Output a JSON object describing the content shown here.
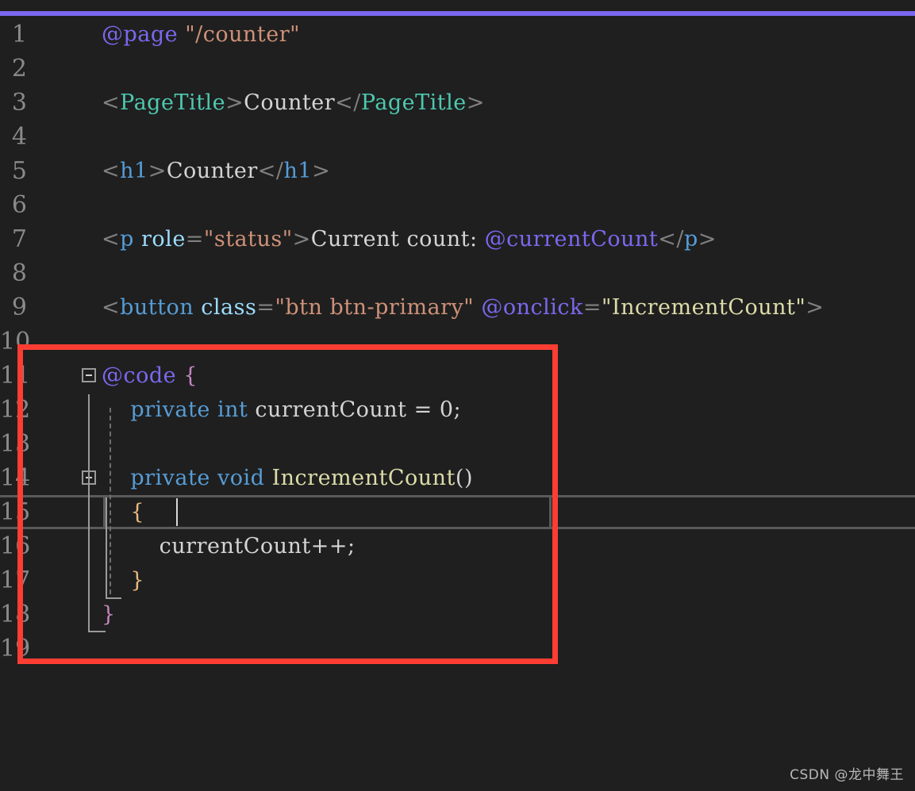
{
  "editor": {
    "theme_background": "#1f1f1f",
    "accent_color": "#7b68ee",
    "annotation_color": "#fc3d33",
    "gutter_color": "#8a8a8a",
    "lines": [
      {
        "number": "1",
        "text": "@page \"/counter\""
      },
      {
        "number": "2",
        "text": ""
      },
      {
        "number": "3",
        "text": "<PageTitle>Counter</PageTitle>"
      },
      {
        "number": "4",
        "text": ""
      },
      {
        "number": "5",
        "text": "<h1>Counter</h1>"
      },
      {
        "number": "6",
        "text": ""
      },
      {
        "number": "7",
        "text": "<p role=\"status\">Current count: @currentCount</p>"
      },
      {
        "number": "8",
        "text": ""
      },
      {
        "number": "9",
        "text": "<button class=\"btn btn-primary\" @onclick=\"IncrementCount\">"
      },
      {
        "number": "10",
        "text": ""
      },
      {
        "number": "11",
        "text": "@code {"
      },
      {
        "number": "12",
        "text": "    private int currentCount = 0;"
      },
      {
        "number": "13",
        "text": ""
      },
      {
        "number": "14",
        "text": "    private void IncrementCount()"
      },
      {
        "number": "15",
        "text": "    {"
      },
      {
        "number": "16",
        "text": "        currentCount++;"
      },
      {
        "number": "17",
        "text": "    }"
      },
      {
        "number": "18",
        "text": "}"
      },
      {
        "number": "19",
        "text": ""
      }
    ],
    "tokens": {
      "l1_razor": "@page",
      "l1_string": "\"/counter\"",
      "l3_open_lt": "<",
      "l3_comp": "PageTitle",
      "l3_gt": ">",
      "l3_content": "Counter",
      "l3_close_lt": "</",
      "l3_comp2": "PageTitle",
      "l3_gt2": ">",
      "l5_open_lt": "<",
      "l5_tag": "h1",
      "l5_gt": ">",
      "l5_content": "Counter",
      "l5_close_lt": "</",
      "l5_tag2": "h1",
      "l5_gt2": ">",
      "l7_open_lt": "<",
      "l7_tag": "p",
      "l7_space": " ",
      "l7_attr": "role",
      "l7_eq": "=",
      "l7_string": "\"status\"",
      "l7_gt": ">",
      "l7_content": "Current count: ",
      "l7_razor": "@currentCount",
      "l7_close_lt": "</",
      "l7_tag2": "p",
      "l7_gt2": ">",
      "l9_open_lt": "<",
      "l9_tag": "button",
      "l9_space": " ",
      "l9_attr": "class",
      "l9_eq": "=",
      "l9_string": "\"btn btn-primary\"",
      "l9_space2": " ",
      "l9_razor_attr": "@onclick",
      "l9_eq2": "=",
      "l9_string2": "\"IncrementCount\"",
      "l9_gt": ">",
      "l11_razor": "@code",
      "l11_brace": " {",
      "l12_indent": "    ",
      "l12_kw1": "private",
      "l12_kw2": "int",
      "l12_ident": "currentCount",
      "l12_op": "=",
      "l12_num": "0",
      "l12_semi": ";",
      "l14_indent": "    ",
      "l14_kw1": "private",
      "l14_kw2": "void",
      "l14_fn": "IncrementCount",
      "l14_parens": "()",
      "l15_brace": "    {",
      "l16_stmt": "        currentCount++;",
      "l17_brace": "    }",
      "l18_brace": "}"
    }
  },
  "watermark": {
    "text": "CSDN @龙中舞王"
  }
}
